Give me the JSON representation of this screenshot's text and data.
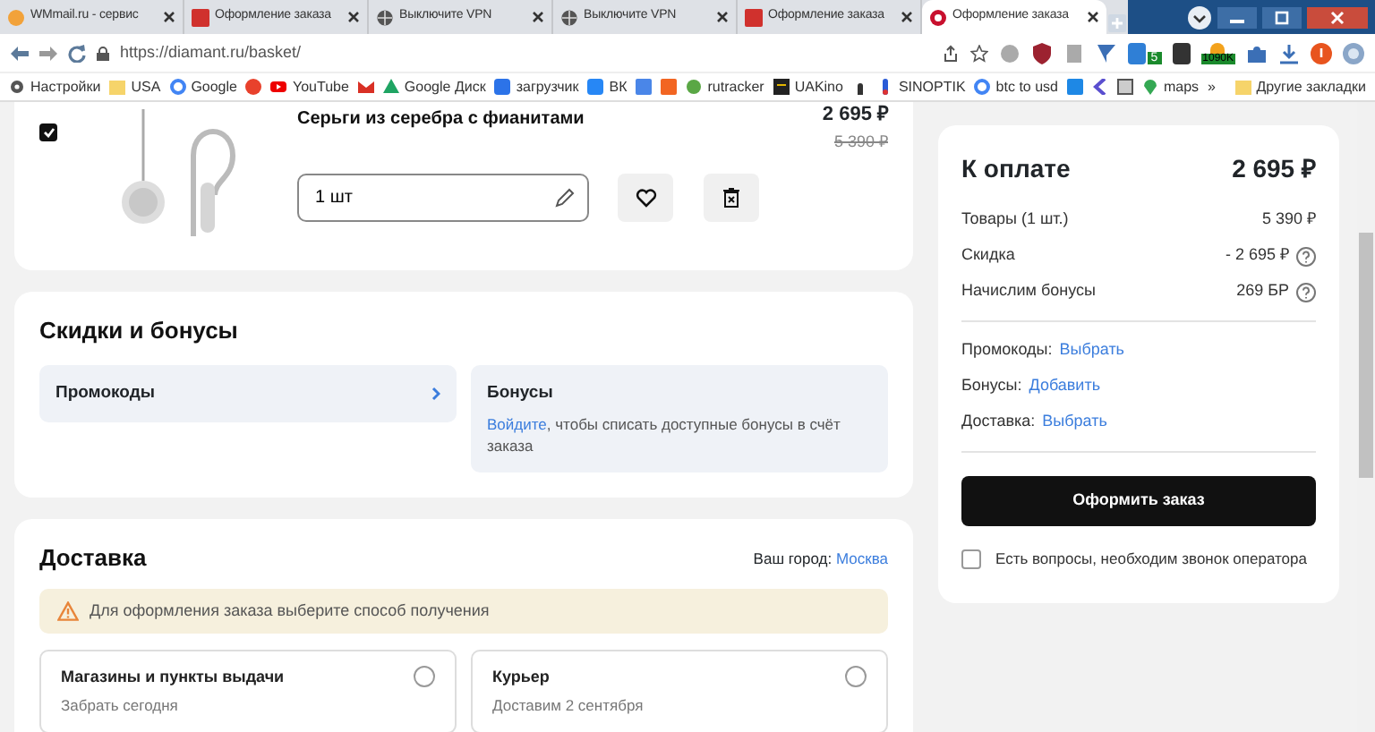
{
  "browser": {
    "tabs": [
      {
        "title": "WMmail.ru - сервис",
        "selected": false
      },
      {
        "title": "Оформление заказа",
        "selected": false
      },
      {
        "title": "Выключите VPN",
        "selected": false
      },
      {
        "title": "Выключите VPN",
        "selected": false
      },
      {
        "title": "Оформление заказа",
        "selected": false
      },
      {
        "title": "Оформление заказа",
        "selected": true
      }
    ],
    "url": "https://diamant.ru/basket/",
    "extension_badges": [
      "5",
      "1090K"
    ],
    "bookmarks": [
      {
        "kind": "link",
        "label": "Настройки"
      },
      {
        "kind": "link",
        "label": "USA"
      },
      {
        "kind": "link",
        "label": "Google"
      },
      {
        "kind": "icon"
      },
      {
        "kind": "link",
        "label": "YouTube"
      },
      {
        "kind": "icon"
      },
      {
        "kind": "link",
        "label": "Google Диск"
      },
      {
        "kind": "link",
        "label": "загрузчик"
      },
      {
        "kind": "link",
        "label": "ВК"
      },
      {
        "kind": "icon"
      },
      {
        "kind": "icon"
      },
      {
        "kind": "link",
        "label": "rutracker"
      },
      {
        "kind": "link",
        "label": "UAKino"
      },
      {
        "kind": "icon"
      },
      {
        "kind": "link",
        "label": "SINOPTIK"
      },
      {
        "kind": "link",
        "label": "btc to usd"
      },
      {
        "kind": "icon"
      },
      {
        "kind": "icon"
      },
      {
        "kind": "icon"
      },
      {
        "kind": "link",
        "label": "maps"
      }
    ],
    "more": "»",
    "other_bookmarks": "Другие закладки"
  },
  "product": {
    "checked": true,
    "name": "Серьги из серебра с фианитами",
    "price": "2 695 ₽",
    "old_price": "5 390 ₽",
    "quantity": "1 шт"
  },
  "discounts": {
    "title": "Скидки и бонусы",
    "promo": "Промокоды",
    "bonus_title": "Бонусы",
    "bonus_link": "Войдите",
    "bonus_text": ", чтобы списать доступные бонусы в счёт заказа"
  },
  "delivery": {
    "title": "Доставка",
    "city_label": "Ваш город:",
    "city": "Москва",
    "warning": "Для оформления заказа выберите способ получения",
    "options": [
      {
        "title": "Магазины и пункты выдачи",
        "subtitle": "Забрать сегодня",
        "selected": false
      },
      {
        "title": "Курьер",
        "subtitle": "Доставим 2 сентября",
        "selected": false
      }
    ]
  },
  "summary": {
    "title": "К оплате",
    "total": "2 695 ₽",
    "lines": [
      {
        "label": "Товары (1 шт.)",
        "value": "5 390 ₽",
        "help": false
      },
      {
        "label": "Скидка",
        "value": "- 2 695 ₽",
        "help": true
      },
      {
        "label": "Начислим бонусы",
        "value": "269 БР",
        "help": true
      }
    ],
    "links": [
      {
        "label": "Промокоды:",
        "action": "Выбрать"
      },
      {
        "label": "Бонусы:",
        "action": "Добавить"
      },
      {
        "label": "Доставка:",
        "action": "Выбрать"
      }
    ],
    "order_button": "Оформить заказ",
    "callback": {
      "label": "Есть вопросы, необходим звонок оператора",
      "checked": false
    }
  }
}
